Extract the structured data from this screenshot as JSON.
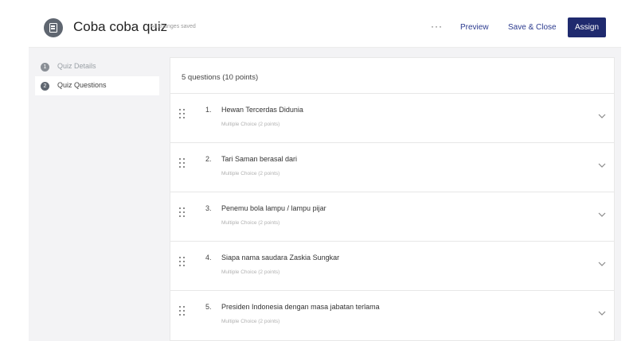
{
  "header": {
    "title": "Coba coba quiz",
    "status": "All changes saved",
    "more": "···",
    "preview_label": "Preview",
    "save_close_label": "Save & Close",
    "assign_label": "Assign"
  },
  "sidebar": {
    "items": [
      {
        "label": "Quiz Details",
        "active": false
      },
      {
        "label": "Quiz Questions",
        "active": true
      }
    ]
  },
  "main": {
    "summary": "5 questions  (10 points)",
    "questions": [
      {
        "number": "1.",
        "text": "Hewan Tercerdas Didunia",
        "meta": "Multiple Choice (2 points)"
      },
      {
        "number": "2.",
        "text": "Tari Saman berasal dari",
        "meta": "Multiple Choice (2 points)"
      },
      {
        "number": "3.",
        "text": "Penemu bola lampu / lampu pijar",
        "meta": "Multiple Choice (2 points)"
      },
      {
        "number": "4.",
        "text": "Siapa nama saudara Zaskia Sungkar",
        "meta": "Multiple Choice (2 points)"
      },
      {
        "number": "5.",
        "text": "Presiden Indonesia dengan masa jabatan terlama",
        "meta": "Multiple Choice (2 points)"
      }
    ]
  },
  "colors": {
    "accent": "#1f2a6e",
    "link": "#2b3a8f",
    "background": "#f3f3f5"
  },
  "icons": {
    "quiz": "quiz-document-icon",
    "drag": "drag-handle-icon",
    "expand": "chevron-down-icon"
  }
}
